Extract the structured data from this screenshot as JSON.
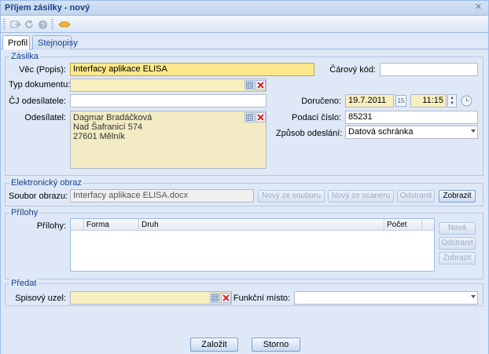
{
  "window": {
    "title": "Příjem zásilky - nový"
  },
  "tabs": [
    {
      "label": "Profil"
    },
    {
      "label": "Stejnopisy"
    }
  ],
  "zasilka": {
    "legend": "Zásilka",
    "vec_label": "Věc (Popis):",
    "vec_value": "Interfacy aplikace ELISA",
    "typ_label": "Typ dokumentu:",
    "typ_value": "",
    "cj_label": "ČJ odesílatele:",
    "cj_value": "",
    "odesilatel_label": "Odesílatel:",
    "odesilatel_lines": [
      "Dagmar Bradáčková",
      "Nad Šafranicí 574",
      "27601 Mělník"
    ],
    "carovy_label": "Čárový kód:",
    "carovy_value": "",
    "doruceno_label": "Doručeno:",
    "doruceno_date": "19.7.2011",
    "doruceno_time": "11:15",
    "calendar_day": "15",
    "podaci_label": "Podací číslo:",
    "podaci_value": "85231",
    "zpusob_label": "Způsob odeslání:",
    "zpusob_value": "Datová schránka"
  },
  "elektronicky": {
    "legend": "Elektronický obraz",
    "soubor_label": "Soubor obrazu:",
    "soubor_value": "Interfacy aplikace ELISA.docx",
    "btn_novy_soubor": "Nový ze souboru",
    "btn_novy_scaneru": "Nový ze scaneru",
    "btn_odstranit": "Odstranit",
    "btn_zobrazit": "Zobrazit"
  },
  "prilohy": {
    "legend": "Přílohy",
    "label": "Přílohy:",
    "columns": [
      "Forma",
      "Druh",
      "Počet"
    ],
    "btn_nova": "Nová",
    "btn_odstranit": "Odstranit",
    "btn_zobrazit": "Zobrazit"
  },
  "predat": {
    "legend": "Předat",
    "spisovy_label": "Spisový uzel:",
    "spisovy_value": "",
    "funkcni_label": "Funkční místo:",
    "funkcni_value": ""
  },
  "footer": {
    "btn_zalozit": "Založit",
    "btn_storno": "Storno"
  },
  "colors": {
    "accent": "#15428b",
    "panel": "#dfe8f6",
    "required": "#f7efc0",
    "highlight": "#fde98b"
  }
}
